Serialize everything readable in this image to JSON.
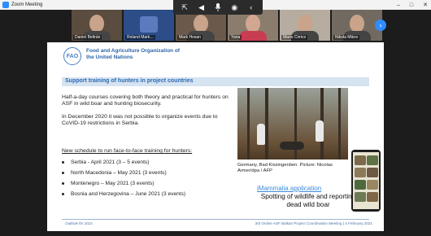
{
  "window": {
    "title": "Zoom Meeting",
    "controls": [
      "–",
      "□",
      "✕"
    ]
  },
  "toolbar": {
    "items": [
      {
        "name": "share-screen",
        "glyph": "⇱"
      },
      {
        "name": "volume",
        "glyph": "◀"
      },
      {
        "name": "microphone",
        "glyph": "🎙"
      },
      {
        "name": "record",
        "glyph": "◉"
      },
      {
        "name": "collapse",
        "glyph": "‹"
      }
    ]
  },
  "participants": [
    {
      "name": "Daniel Beltrán"
    },
    {
      "name": "Roland Mark…"
    },
    {
      "name": "Mark Hosan"
    },
    {
      "name": "Yana"
    },
    {
      "name": "Mario Cirrico"
    },
    {
      "name": "Nikola Mikov"
    }
  ],
  "slide": {
    "org_name": "Food and Agriculture Organization of the United Nations",
    "logo_text": "FAO",
    "subtitle": "Support training of hunters in project countries",
    "paragraph1": "Half-a-day courses covering both theory and practical for hunters on ASF in wild boar and hunting biosecurity.",
    "paragraph2": "In December 2020 it was not possible to organize events due to CoVID-19 restrictions in Serbia.",
    "schedule_title": "New schedule to run face-to-face training for hunters:",
    "schedule": [
      "Serbia -  April 2021 (3 – 5 events)",
      "North Macedonia – May 2021 (3 events)",
      "Montenegro – May 2021 (3 events)",
      "Bosnia and Herzegovina – June 2021 (3 events)"
    ],
    "caption": "Germany, Bad Kissingenben. Picture: Nicolas Armer/dpa / AFP",
    "app_link": "iMammalia application",
    "app_description": "Spotting of wildlife and reporting dead wild boar",
    "footer_left": "Outlook for 2021",
    "footer_right": "3rd Online ASF Balkan Project Coordination  Meeting | 4 February 2021"
  },
  "colors": {
    "fao_blue": "#2f65a8",
    "subtitle_bar": "#d6e3f1",
    "link_blue": "#3b8ad8",
    "zoom_blue": "#2d8cff"
  }
}
